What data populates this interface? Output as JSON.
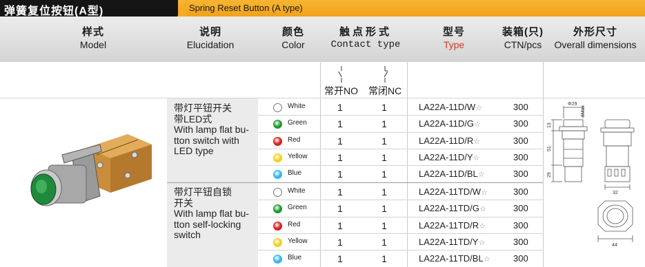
{
  "banner": {
    "title_cn": "弹簧复位按钮(A型)",
    "title_en": "Spring Reset Button (A type)"
  },
  "header": {
    "model_cn": "样式",
    "model_en": "Model",
    "desc_cn": "说明",
    "desc_en": "Elucidation",
    "color_cn": "颜色",
    "color_en": "Color",
    "contact_cn": "触点形式",
    "contact_en": "Contact type",
    "type_cn": "型号",
    "type_en": "Type",
    "ctn_cn": "装箱(只)",
    "ctn_en": "CTN/pcs",
    "dim_cn": "外形尺寸",
    "dim_en": "Overall dimensions"
  },
  "contacts": {
    "no": "常开NO",
    "nc": "常闭NC"
  },
  "groups": [
    {
      "desc": [
        "带灯平钮开关",
        "带LED式",
        "With lamp flat bu-",
        "tton switch with",
        "LED type"
      ],
      "rows": [
        {
          "color": "White",
          "no": "1",
          "nc": "1",
          "model": "LA22A-11D/W",
          "qty": "300"
        },
        {
          "color": "Green",
          "no": "1",
          "nc": "1",
          "model": "LA22A-11D/G",
          "qty": "300"
        },
        {
          "color": "Red",
          "no": "1",
          "nc": "1",
          "model": "LA22A-11D/R",
          "qty": "300"
        },
        {
          "color": "Yellow",
          "no": "1",
          "nc": "1",
          "model": "LA22A-11D/Y",
          "qty": "300"
        },
        {
          "color": "Blue",
          "no": "1",
          "nc": "1",
          "model": "LA22A-11D/BL",
          "qty": "300"
        }
      ]
    },
    {
      "desc": [
        "带灯平钮自锁",
        "开关",
        "With lamp flat bu-",
        "tton self-locking",
        "switch"
      ],
      "rows": [
        {
          "color": "White",
          "no": "1",
          "nc": "1",
          "model": "LA22A-11TD/W",
          "qty": "300"
        },
        {
          "color": "Green",
          "no": "1",
          "nc": "1",
          "model": "LA22A-11TD/G",
          "qty": "300"
        },
        {
          "color": "Red",
          "no": "1",
          "nc": "1",
          "model": "LA22A-11TD/R",
          "qty": "300"
        },
        {
          "color": "Yellow",
          "no": "1",
          "nc": "1",
          "model": "LA22A-11TD/Y",
          "qty": "300"
        },
        {
          "color": "Blue",
          "no": "1",
          "nc": "1",
          "model": "LA22A-11TD/BL",
          "qty": "300"
        }
      ]
    }
  ],
  "star_glyph": "☆",
  "lamp_colors": {
    "White": "#ffffff",
    "Green": "#1f9a2e",
    "Red": "#d62020",
    "Yellow": "#f2d21a",
    "Blue": "#35b8ec"
  },
  "dimensions": {
    "d29": "Φ29",
    "max8": "8Max",
    "h13": "13",
    "h51": "51",
    "h29": "29",
    "w32": "32",
    "w44": "44"
  }
}
